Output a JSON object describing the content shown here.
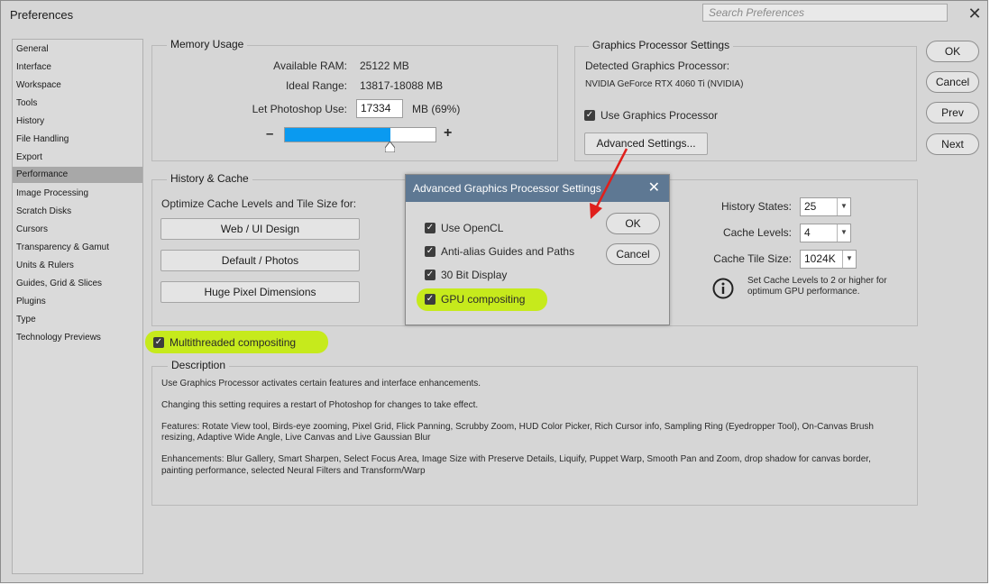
{
  "window": {
    "title": "Preferences",
    "search_placeholder": "Search Preferences"
  },
  "sidebar": {
    "items": [
      {
        "label": "General"
      },
      {
        "label": "Interface"
      },
      {
        "label": "Workspace"
      },
      {
        "label": "Tools"
      },
      {
        "label": "History"
      },
      {
        "label": "File Handling"
      },
      {
        "label": "Export"
      },
      {
        "label": "Performance"
      },
      {
        "label": "Image Processing"
      },
      {
        "label": "Scratch Disks"
      },
      {
        "label": "Cursors"
      },
      {
        "label": "Transparency & Gamut"
      },
      {
        "label": "Units & Rulers"
      },
      {
        "label": "Guides, Grid & Slices"
      },
      {
        "label": "Plugins"
      },
      {
        "label": "Type"
      },
      {
        "label": "Technology Previews"
      }
    ],
    "selected": "Performance"
  },
  "memory": {
    "legend": "Memory Usage",
    "available_label": "Available RAM:",
    "available_value": "25122 MB",
    "ideal_label": "Ideal Range:",
    "ideal_value": "13817-18088 MB",
    "let_label": "Let Photoshop Use:",
    "let_value": "17334",
    "let_suffix": "MB (69%)",
    "slider_fraction": 0.69,
    "minus": "–",
    "plus": "+"
  },
  "gpu": {
    "legend": "Graphics Processor Settings",
    "detected_label": "Detected Graphics Processor:",
    "detected_value": "NVIDIA GeForce RTX 4060 Ti (NVIDIA)",
    "use_gpu_label": "Use Graphics Processor",
    "advanced_button": "Advanced Settings..."
  },
  "history_cache": {
    "legend": "History & Cache",
    "optimize_label": "Optimize Cache Levels and Tile Size for:",
    "buttons": [
      "Web / UI Design",
      "Default / Photos",
      "Huge Pixel Dimensions"
    ],
    "history_states_label": "History States:",
    "history_states_value": "25",
    "cache_levels_label": "Cache Levels:",
    "cache_levels_value": "4",
    "tile_size_label": "Cache Tile Size:",
    "tile_size_value": "1024K",
    "info_text_1": "Set Cache Levels to 2 or higher for",
    "info_text_2": "optimum GPU performance."
  },
  "multithreaded": {
    "label": "Multithreaded compositing"
  },
  "description": {
    "legend": "Description",
    "p1": "Use Graphics Processor activates certain features and interface enhancements.",
    "p2": "Changing this setting requires a restart of Photoshop for changes to take effect.",
    "p3a": "Features: Rotate View tool, Birds-eye zooming, Pixel Grid, Flick Panning, Scrubby Zoom, HUD Color Picker, Rich Cursor info, Sampling Ring (Eyedropper Tool), On-Canvas Brush",
    "p3b": "resizing, Adaptive Wide Angle, Live Canvas and Live Gaussian Blur",
    "p4a": "Enhancements: Blur Gallery, Smart Sharpen, Select Focus Area, Image Size with Preserve Details, Liquify, Puppet Warp, Smooth Pan and Zoom, drop shadow for canvas border,",
    "p4b": "painting performance, selected Neural Filters and Transform/Warp"
  },
  "right_buttons": {
    "ok": "OK",
    "cancel": "Cancel",
    "prev": "Prev",
    "next": "Next"
  },
  "dialog": {
    "title": "Advanced Graphics Processor Settings",
    "options": [
      "Use OpenCL",
      "Anti-alias Guides and Paths",
      "30 Bit Display",
      "GPU compositing"
    ],
    "ok": "OK",
    "cancel": "Cancel"
  },
  "colors": {
    "highlight": "#c6ea1c",
    "slider_fill": "#0a9af0",
    "dialog_title_bar": "#5e7893",
    "arrow": "#e0201c"
  }
}
